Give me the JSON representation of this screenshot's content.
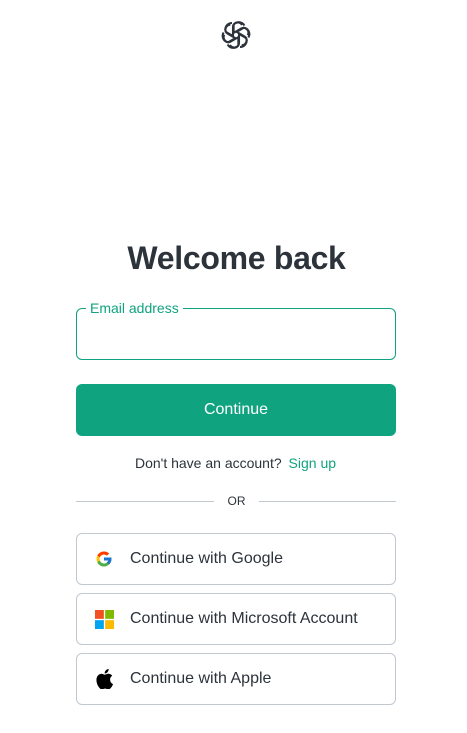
{
  "heading": "Welcome back",
  "email": {
    "label": "Email address",
    "value": ""
  },
  "continue_label": "Continue",
  "signup": {
    "prompt": "Don't have an account?",
    "link": "Sign up"
  },
  "divider_text": "OR",
  "social": {
    "google": "Continue with Google",
    "microsoft": "Continue with Microsoft Account",
    "apple": "Continue with Apple"
  },
  "colors": {
    "accent": "#10a37f",
    "text": "#2d333a",
    "border": "#c2c8d0"
  },
  "icons": [
    "openai-logo-icon",
    "google-icon",
    "microsoft-icon",
    "apple-icon"
  ]
}
